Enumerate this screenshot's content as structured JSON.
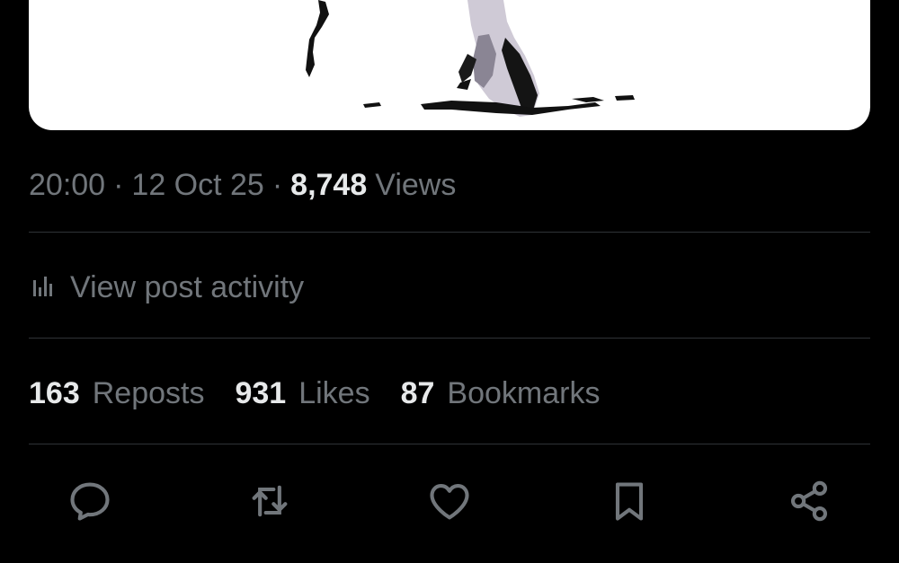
{
  "post": {
    "time": "20:00",
    "separator": "·",
    "date": "12 Oct 25",
    "views_count": "8,748",
    "views_label": "Views"
  },
  "activity": {
    "label": "View post activity",
    "icon": "analytics-icon"
  },
  "stats": {
    "reposts_count": "163",
    "reposts_label": "Reposts",
    "likes_count": "931",
    "likes_label": "Likes",
    "bookmarks_count": "87",
    "bookmarks_label": "Bookmarks"
  },
  "actions": [
    {
      "name": "reply",
      "icon": "reply-icon"
    },
    {
      "name": "repost",
      "icon": "repost-icon"
    },
    {
      "name": "like",
      "icon": "heart-icon"
    },
    {
      "name": "bookmark",
      "icon": "bookmark-icon"
    },
    {
      "name": "share",
      "icon": "share-icon"
    }
  ],
  "colors": {
    "background": "#000000",
    "primary_text": "#e7e9ea",
    "secondary_text": "#71767b",
    "divider": "#2f3336",
    "media_background": "#ffffff"
  }
}
